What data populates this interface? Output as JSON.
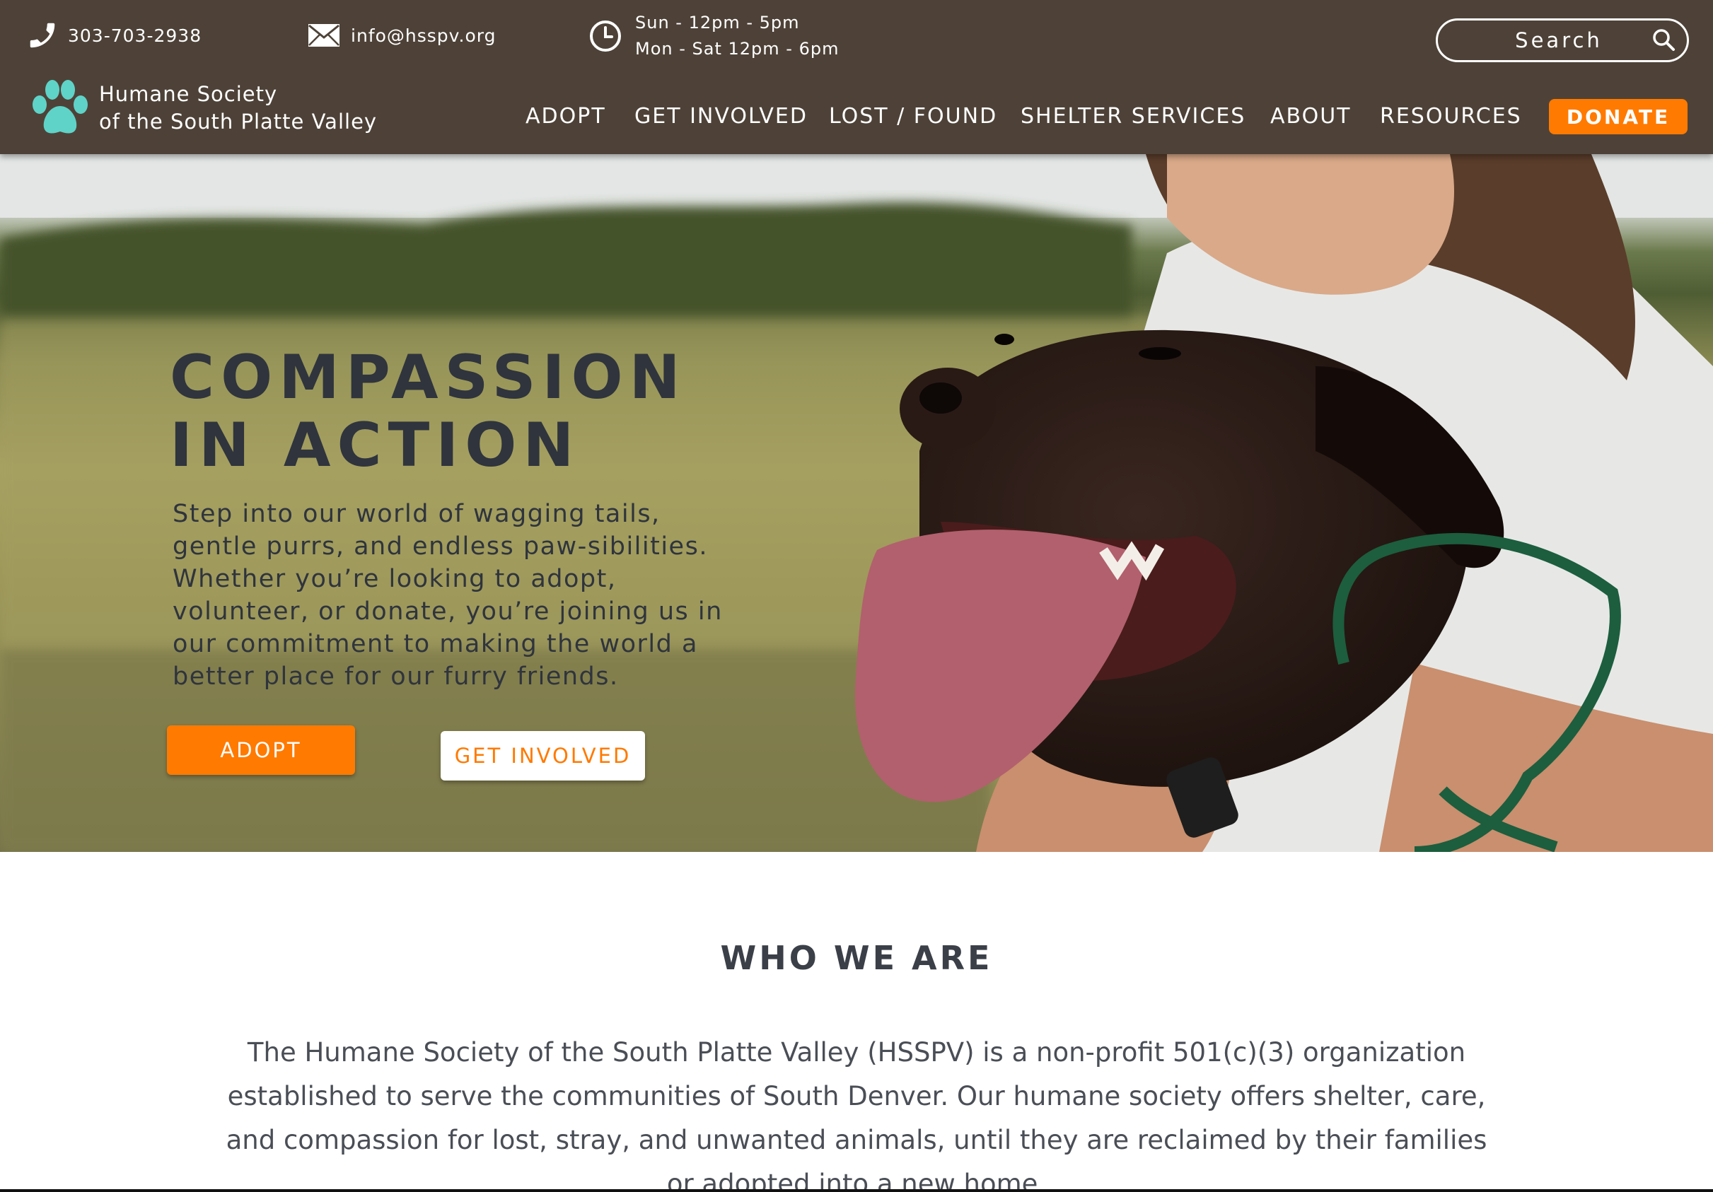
{
  "topbar": {
    "phone": "303-703-2938",
    "email": "info@hsspv.org",
    "hours": [
      "Sun - 12pm - 5pm",
      "Mon - Sat 12pm - 6pm"
    ],
    "search_placeholder": "Search"
  },
  "logo": {
    "line1": "Humane Society",
    "line2": "of the South Platte Valley",
    "paw_color": "#5fd3c8"
  },
  "nav": {
    "items": [
      "ADOPT",
      "GET INVOLVED",
      "LOST / FOUND",
      "SHELTER SERVICES",
      "ABOUT",
      "RESOURCES"
    ],
    "donate_label": "DONATE"
  },
  "hero": {
    "title": "COMPASSION\nIN ACTION",
    "text": "Step into our world of wagging tails, gentle purrs, and endless paw-sibilities. Whether you’re looking to adopt, volunteer, or donate, you’re joining us in our commitment to making the world a better place for our furry friends.",
    "adopt_label": "ADOPT",
    "get_involved_label": "GET INVOLVED"
  },
  "who_we_are": {
    "title": "WHO WE ARE",
    "text": "The Humane Society of the South Platte Valley (HSSPV) is a non-profit 501(c)(3) organization established to serve the communities of South Denver. Our humane society offers shelter, care, and compassion for lost, stray, and unwanted animals, until they are reclaimed by their families or adopted into a new home."
  },
  "colors": {
    "header_bg": "#4e4238",
    "accent_orange": "#ff7a00",
    "text_dark": "#2f343d"
  }
}
